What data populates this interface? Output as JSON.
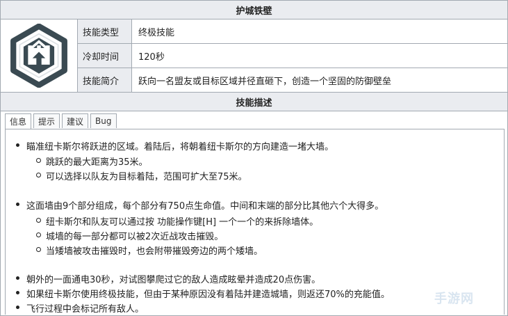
{
  "title": "护城铁壁",
  "skill_icon": "fortified-wall-hexagon-icon",
  "info_rows": [
    {
      "label": "技能类型",
      "value": "终极技能"
    },
    {
      "label": "冷却时间",
      "value": "120秒"
    },
    {
      "label": "技能简介",
      "value": "跃向一名盟友或目标区域并径直砸下，创造一个坚固的防御壁垒"
    }
  ],
  "section_title": "技能描述",
  "tabs": [
    "信息",
    "提示",
    "建议",
    "Bug"
  ],
  "active_tab": "信息",
  "description": {
    "group1": {
      "main": "瞄准纽卡斯尔将跃进的区域。着陆后，将朝着纽卡斯尔的方向建造一堵大墙。",
      "subs": [
        "跳跃的最大距离为35米。",
        "可以选择以队友为目标着陆，范围可扩大至75米。"
      ]
    },
    "group2": {
      "main": "这面墙由9个部分组成，每个部分有750点生命值。中间和末端的部分比其他六个大得多。",
      "subs": [
        "纽卡斯尔和队友可以通过按 功能操作键[H] 一个一个的来拆除墙体。",
        "城墙的每一部分都可以被2次近战攻击摧毁。",
        "当矮墙被攻击摧毁时，也会附带摧毁旁边的两个矮墙。"
      ]
    },
    "group3": [
      "朝外的一面通电30秒，对试图攀爬过它的敌人造成眩晕并造成20点伤害。",
      "如果纽卡斯尔使用终极技能，但由于某种原因没有着陆并建造城墙，则返还70%的充能值。",
      "飞行过程中会标记所有敌人。"
    ]
  },
  "watermark": "手游网",
  "colors": {
    "header_bg": "#eaecf0",
    "border": "#a2a9b1",
    "icon_dark": "#3a4a52"
  }
}
